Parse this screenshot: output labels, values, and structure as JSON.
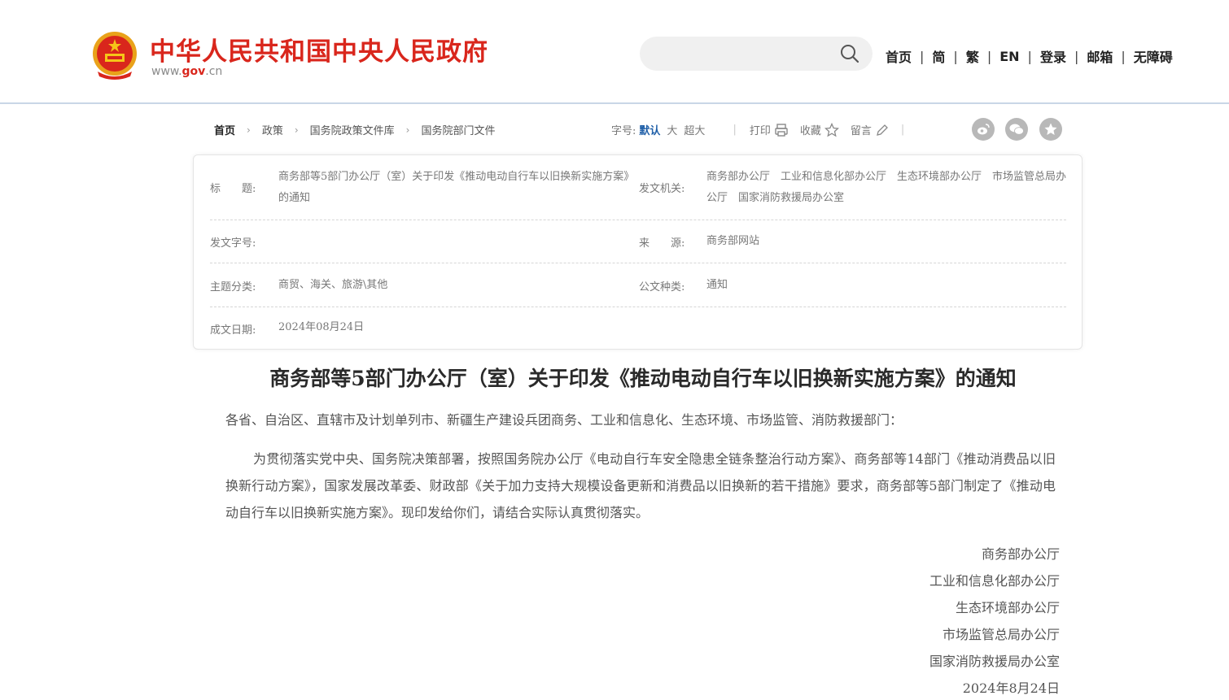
{
  "header": {
    "site_title": "中华人民共和国中央人民政府",
    "domain_www": "www.",
    "domain_gov": "gov",
    "domain_cn": ".cn",
    "search_placeholder": "",
    "nav": [
      "首页",
      "简",
      "繁",
      "EN",
      "登录",
      "邮箱",
      "无障碍"
    ],
    "nav_separator": "|"
  },
  "breadcrumb": {
    "items": [
      "首页",
      "政策",
      "国务院政策文件库",
      "国务院部门文件"
    ],
    "separator": "›"
  },
  "tools": {
    "font_size_label": "字号:",
    "font_default": "默认",
    "font_large": "大",
    "font_xlarge": "超大",
    "divider": "|",
    "print": "打印",
    "favorite": "收藏",
    "comment": "留言"
  },
  "share_icons": [
    "weibo-icon",
    "wechat-icon",
    "qzone-icon"
  ],
  "meta": {
    "title_label": "标　　题:",
    "title_value": "商务部等5部门办公厅（室）关于印发《推动电动自行车以旧换新实施方案》的通知",
    "issuer_label": "发文机关:",
    "issuer_value": "商务部办公厅　工业和信息化部办公厅　生态环境部办公厅　市场监管总局办公厅　国家消防救援局办公室",
    "doc_no_label": "发文字号:",
    "doc_no_value": "",
    "source_label": "来　　源:",
    "source_value": "商务部网站",
    "topic_label": "主题分类:",
    "topic_value": "商贸、海关、旅游\\其他",
    "type_label": "公文种类:",
    "type_value": "通知",
    "date_label": "成文日期:",
    "date_value": "2024年08月24日"
  },
  "article": {
    "title": "商务部等5部门办公厅（室）关于印发《推动电动自行车以旧换新实施方案》的通知",
    "salutation": "各省、自治区、直辖市及计划单列市、新疆生产建设兵团商务、工业和信息化、生态环境、市场监管、消防救援部门：",
    "body": "为贯彻落实党中央、国务院决策部署，按照国务院办公厅《电动自行车安全隐患全链条整治行动方案》、商务部等14部门《推动消费品以旧换新行动方案》，国家发展改革委、财政部《关于加力支持大规模设备更新和消费品以旧换新的若干措施》要求，商务部等5部门制定了《推动电动自行车以旧换新实施方案》。现印发给你们，请结合实际认真贯彻落实。",
    "signatures": [
      "商务部办公厅",
      "工业和信息化部办公厅",
      "生态环境部办公厅",
      "市场监管总局办公厅",
      "国家消防救援局办公室",
      "2024年8月24日"
    ]
  },
  "colors": {
    "brand_red": "#d9261c",
    "link_blue": "#1f5fa8",
    "header_rule": "#c9d6e6"
  }
}
